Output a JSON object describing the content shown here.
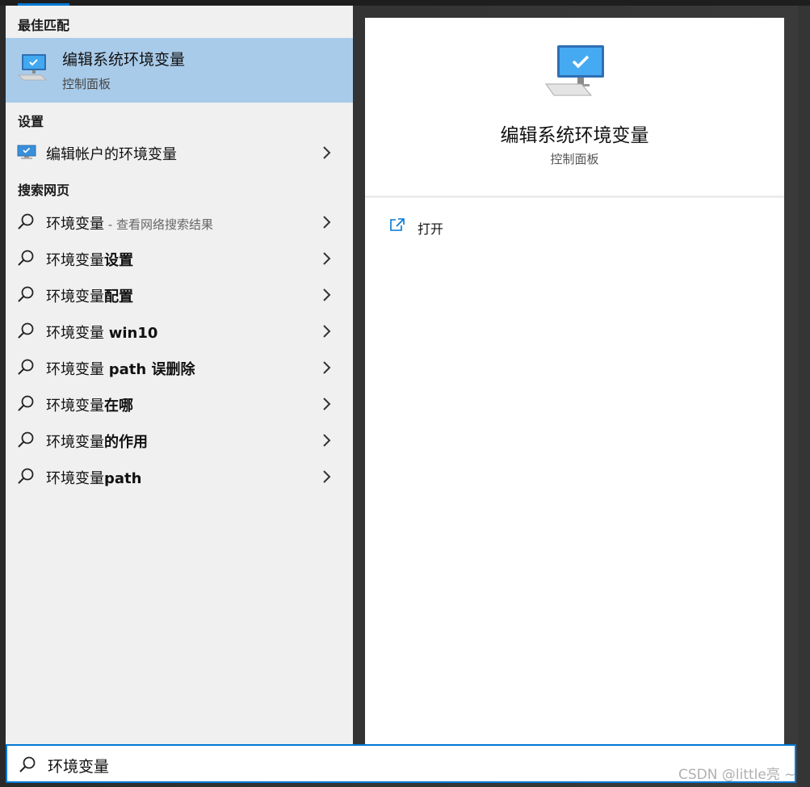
{
  "sections": {
    "best_match": "最佳匹配",
    "settings": "设置",
    "web": "搜索网页"
  },
  "best_match": {
    "title": "编辑系统环境变量",
    "subtitle": "控制面板",
    "icon": "computer-monitor-icon"
  },
  "settings_item": {
    "label": "编辑帐户的环境变量",
    "icon": "computer-monitor-icon"
  },
  "web_results": [
    {
      "normal": "环境变量",
      "bold": "",
      "sub": " - 查看网络搜索结果"
    },
    {
      "normal": "环境变量",
      "bold": "设置",
      "sub": ""
    },
    {
      "normal": "环境变量",
      "bold": "配置",
      "sub": ""
    },
    {
      "normal": "环境变量 ",
      "bold": "win10",
      "sub": ""
    },
    {
      "normal": "环境变量 ",
      "bold": "path 误删除",
      "sub": ""
    },
    {
      "normal": "环境变量",
      "bold": "在哪",
      "sub": ""
    },
    {
      "normal": "环境变量",
      "bold": "的作用",
      "sub": ""
    },
    {
      "normal": "环境变量",
      "bold": "path",
      "sub": ""
    }
  ],
  "preview": {
    "title": "编辑系统环境变量",
    "subtitle": "控制面板",
    "actions": [
      {
        "label": "打开",
        "icon": "open-external-icon"
      }
    ]
  },
  "search": {
    "value": "环境变量",
    "icon": "search-icon"
  },
  "watermark": "CSDN @little亮 ~",
  "colors": {
    "accent": "#0078d4",
    "selected_bg": "#a9cbea",
    "left_bg": "#f0f0f0"
  }
}
